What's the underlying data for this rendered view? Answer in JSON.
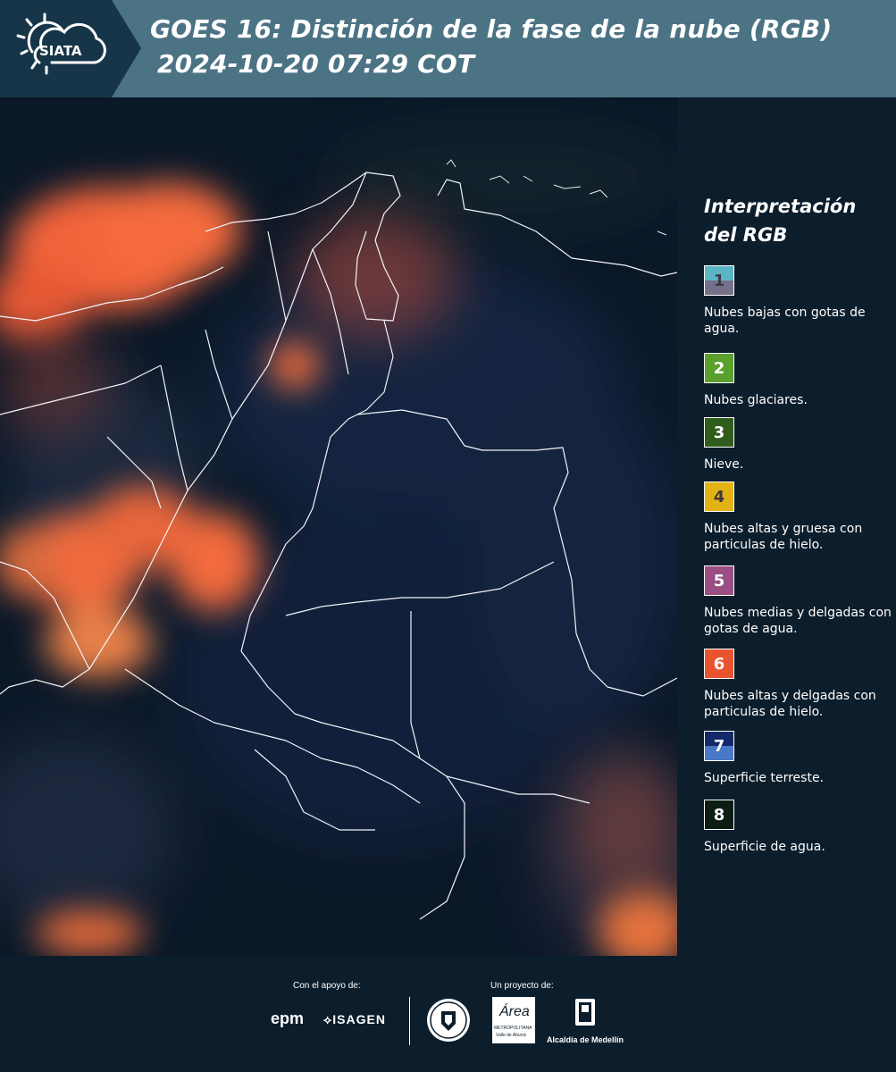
{
  "header": {
    "title_line1": "GOES 16: Distinción de la fase de la nube (RGB)",
    "title_line2": "2024-10-20 07:29 COT",
    "logo_text": "SIATA",
    "color": "#4b7384"
  },
  "legend": {
    "title": "Interpretación del RGB",
    "items": [
      {
        "num": "1",
        "desc": "Nubes bajas con gotas de agua.",
        "top": "#5cb5c4",
        "bottom": "#76708a",
        "num_color": "#3a3a48"
      },
      {
        "num": "2",
        "desc": "Nubes glaciares.",
        "top": "#5aa02c",
        "bottom": "#5aa02c",
        "num_color": "#ffffff"
      },
      {
        "num": "3",
        "desc": "Nieve.",
        "top": "#2f5d1c",
        "bottom": "#2f5d1c",
        "num_color": "#ffffff"
      },
      {
        "num": "4",
        "desc": "Nubes altas y gruesa con particulas de hielo.",
        "top": "#e3b214",
        "bottom": "#e3b214",
        "num_color": "#3a3a3a"
      },
      {
        "num": "5",
        "desc": "Nubes medias y delgadas con gotas de agua.",
        "top": "#9a4e83",
        "bottom": "#9a4e83",
        "num_color": "#ffffff"
      },
      {
        "num": "6",
        "desc": "Nubes altas y delgadas con particulas de hielo.",
        "top": "#e9542f",
        "bottom": "#e9542f",
        "num_color": "#ffffff"
      },
      {
        "num": "7",
        "desc": "Superficie terreste.",
        "top": "#14296a",
        "bottom": "#4a78c9",
        "num_color": "#ffffff"
      },
      {
        "num": "8",
        "desc": "Superficie de agua.",
        "top": "#0d1d13",
        "bottom": "#0d1d13",
        "num_color": "#ffffff"
      }
    ]
  },
  "footer": {
    "support_label": "Con el apoyo de:",
    "project_label": "Un proyecto de:",
    "epm": "epm",
    "isagen": "ISAGEN",
    "area_brand": "Área",
    "area_sub1": "METROPOLITANA",
    "area_sub2": "Valle de Aburrá",
    "alcaldia": "Alcaldía de Medellín"
  }
}
